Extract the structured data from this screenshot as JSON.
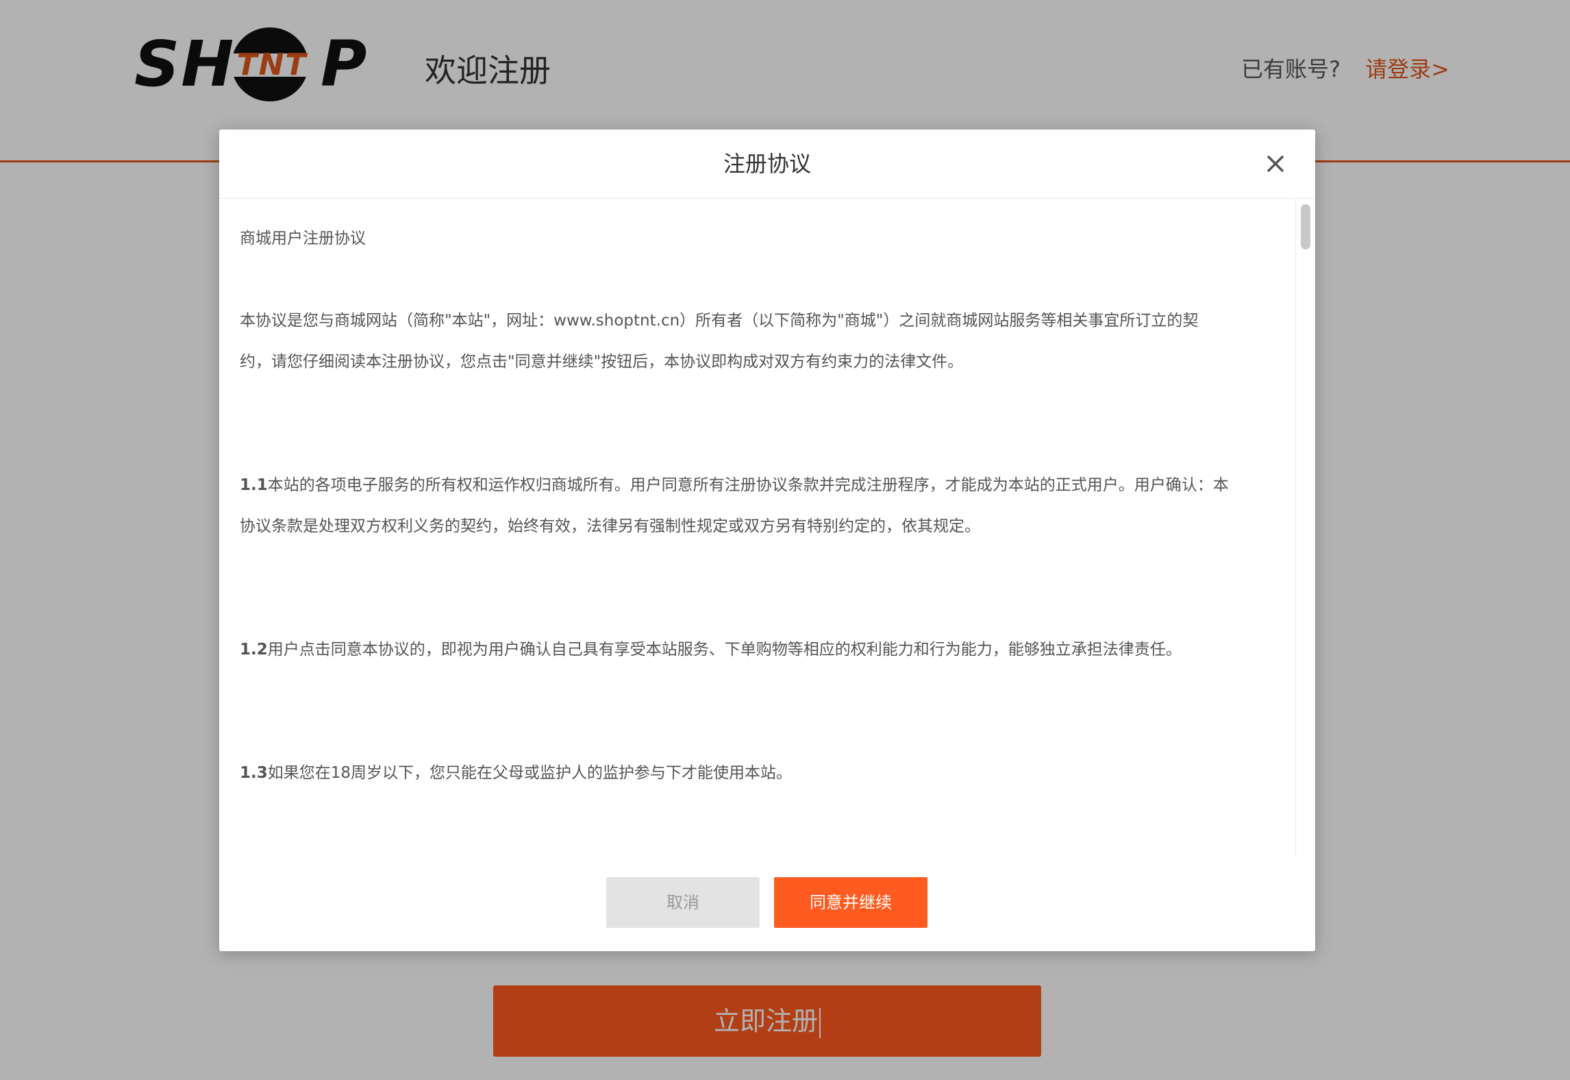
{
  "header": {
    "logo": {
      "text_left": "SH",
      "text_middle": "TNT",
      "text_right": "P"
    },
    "welcome_text": "欢迎注册",
    "login_prompt": "已有账号?",
    "login_link": "请登录>"
  },
  "register_button_label": "立即注册",
  "colors": {
    "accent": "#e0561c",
    "button_orange": "#ff5a1f",
    "cancel_gray": "#e3e3e3"
  },
  "modal": {
    "title": "注册协议",
    "close_icon": "close-icon",
    "agreement": {
      "heading": "商城用户注册协议",
      "intro_line1": "本协议是您与商城网站（简称\"本站\"，网址：www.shoptnt.cn）所有者（以下简称为\"商城\"）之间就商城网站服务等相关事宜所订立的契",
      "intro_line2": "约，请您仔细阅读本注册协议，您点击\"同意并继续\"按钮后，本协议即构成对双方有约束力的法律文件。",
      "clauses": [
        {
          "number": "1.1",
          "line1": "本站的各项电子服务的所有权和运作权归商城所有。用户同意所有注册协议条款并完成注册程序，才能成为本站的正式用户。用户确认：本",
          "line2": "协议条款是处理双方权利义务的契约，始终有效，法律另有强制性规定或双方另有特别约定的，依其规定。"
        },
        {
          "number": "1.2",
          "line1": "用户点击同意本协议的，即视为用户确认自己具有享受本站服务、下单购物等相应的权利能力和行为能力，能够独立承担法律责任。"
        },
        {
          "number": "1.3",
          "line1": "如果您在18周岁以下，您只能在父母或监护人的监护参与下才能使用本站。"
        }
      ]
    },
    "cancel_label": "取消",
    "agree_label": "同意并继续"
  }
}
